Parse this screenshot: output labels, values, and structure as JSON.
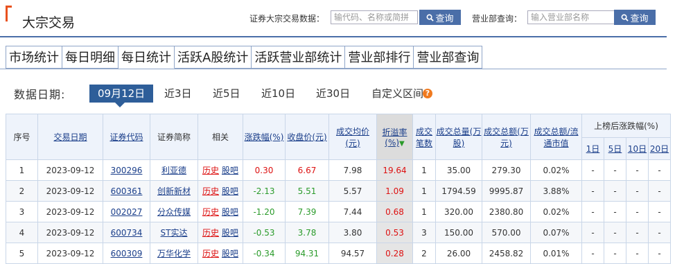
{
  "header": {
    "title": "大宗交易",
    "security_search": {
      "label": "证券大宗交易数据：",
      "placeholder": "输代码、名称或简拼",
      "button": "查询"
    },
    "dept_search": {
      "label": "营业部查询：",
      "placeholder": "输入营业部名称",
      "button": "查询"
    }
  },
  "tabs": [
    "市场统计",
    "每日明细",
    "每日统计",
    "活跃A股统计",
    "活跃营业部统计",
    "营业部排行",
    "营业部查询"
  ],
  "active_tab": "每日统计",
  "date_filter": {
    "label": "数据日期:",
    "options": [
      "09月12日",
      "近3日",
      "近5日",
      "近10日",
      "近30日",
      "自定义区间"
    ],
    "selected": "09月12日"
  },
  "table": {
    "headers": {
      "index": "序号",
      "date": "交易日期",
      "code": "证券代码",
      "name": "证券简称",
      "related": "相关",
      "change": "涨跌幅(%)",
      "close": "收盘价(元)",
      "avg_price": "成交均价(元)",
      "premium": "折溢率(%)",
      "count": "成交笔数",
      "volume": "成交总量(万股)",
      "amount": "成交总额(万元)",
      "ratio": "成交总额/流通市值",
      "after": "上榜后涨跌幅(%)",
      "after_1": "1日",
      "after_5": "5日",
      "after_10": "10日",
      "after_20": "20日"
    },
    "related_labels": {
      "history": "历史",
      "guba": "股吧"
    },
    "rows": [
      {
        "index": "1",
        "date": "2023-09-12",
        "code": "300296",
        "name": "利亚德",
        "change": "0.30",
        "close": "6.67",
        "avg_price": "7.98",
        "premium": "19.64",
        "count": "1",
        "volume": "35.00",
        "amount": "279.30",
        "ratio": "0.02%",
        "d1": "-",
        "d5": "-",
        "d10": "-",
        "d20": "-"
      },
      {
        "index": "2",
        "date": "2023-09-12",
        "code": "600361",
        "name": "创新新材",
        "change": "-2.13",
        "close": "5.51",
        "avg_price": "5.57",
        "premium": "1.09",
        "count": "1",
        "volume": "1794.59",
        "amount": "9995.87",
        "ratio": "3.88%",
        "d1": "-",
        "d5": "-",
        "d10": "-",
        "d20": "-"
      },
      {
        "index": "3",
        "date": "2023-09-12",
        "code": "002027",
        "name": "分众传媒",
        "change": "-1.20",
        "close": "7.39",
        "avg_price": "7.44",
        "premium": "0.68",
        "count": "1",
        "volume": "320.00",
        "amount": "2380.80",
        "ratio": "0.02%",
        "d1": "-",
        "d5": "-",
        "d10": "-",
        "d20": "-"
      },
      {
        "index": "4",
        "date": "2023-09-12",
        "code": "600734",
        "name": "ST实达",
        "change": "-0.53",
        "close": "3.78",
        "avg_price": "3.80",
        "premium": "0.53",
        "count": "3",
        "volume": "150.00",
        "amount": "570.00",
        "ratio": "0.07%",
        "d1": "-",
        "d5": "-",
        "d10": "-",
        "d20": "-"
      },
      {
        "index": "5",
        "date": "2023-09-12",
        "code": "600309",
        "name": "万华化学",
        "change": "-0.34",
        "close": "94.31",
        "avg_price": "94.57",
        "premium": "0.28",
        "count": "2",
        "volume": "26.00",
        "amount": "2458.82",
        "ratio": "0.01%",
        "d1": "-",
        "d5": "-",
        "d10": "-",
        "d20": "-"
      }
    ]
  }
}
